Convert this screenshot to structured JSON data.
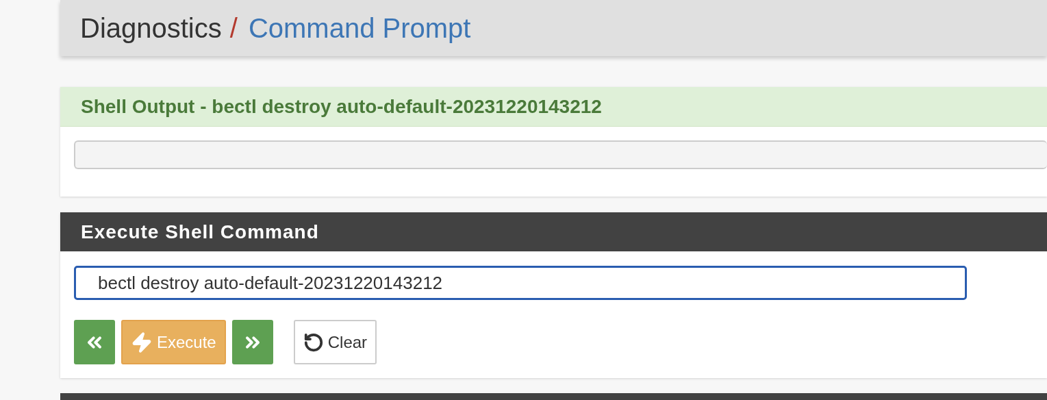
{
  "breadcrumb": {
    "section": "Diagnostics",
    "separator": "/",
    "page": "Command Prompt"
  },
  "output_panel": {
    "title": "Shell Output - bectl destroy auto-default-20231220143212"
  },
  "command_panel": {
    "title": "Execute Shell Command",
    "command": {
      "value": "bectl destroy auto-default-20231220143212",
      "focused": true
    },
    "buttons": [
      {
        "kind": "previous"
      },
      {
        "kind": "execute",
        "label": "Execute"
      },
      {
        "kind": "next"
      },
      {
        "kind": "clear",
        "label": "Clear"
      }
    ]
  }
}
